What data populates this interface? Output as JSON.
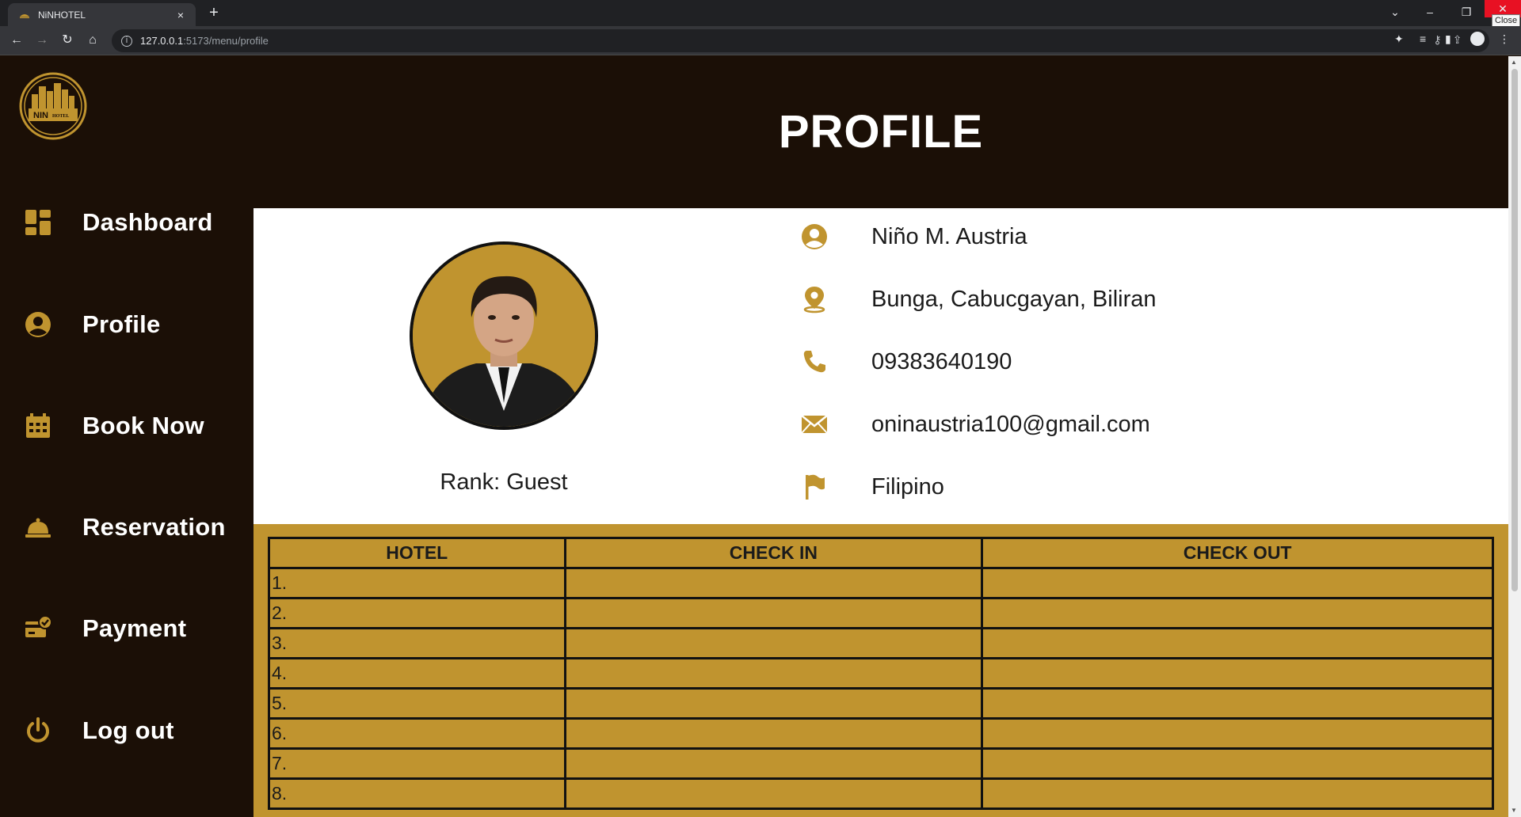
{
  "browser": {
    "tab_title": "NiNHOTEL",
    "tab_close": "×",
    "new_tab": "+",
    "url_host": "127.0.0.1",
    "url_path": ":5173/menu/profile",
    "close_tooltip": "Close"
  },
  "app": {
    "logo_text": "NIN HOTEL",
    "page_title": "PROFILE"
  },
  "sidebar": {
    "items": [
      {
        "label": "Dashboard",
        "icon": "dashboard-icon"
      },
      {
        "label": "Profile",
        "icon": "user-circle-icon"
      },
      {
        "label": "Book Now",
        "icon": "calendar-icon"
      },
      {
        "label": "Reservation",
        "icon": "service-bell-icon"
      },
      {
        "label": "Payment",
        "icon": "card-check-icon"
      },
      {
        "label": "Log out",
        "icon": "power-icon"
      }
    ]
  },
  "profile": {
    "rank": "Rank: Guest",
    "name": "Niño M. Austria",
    "address": "Bunga, Cabucgayan, Biliran",
    "phone": "09383640190",
    "email": "oninaustria100@gmail.com",
    "nationality": "Filipino"
  },
  "history": {
    "columns": [
      "HOTEL",
      "CHECK IN",
      "CHECK OUT"
    ],
    "rows": [
      "1.",
      "2.",
      "3.",
      "4.",
      "5.",
      "6.",
      "7.",
      "8."
    ]
  },
  "colors": {
    "accent": "#c0942f",
    "background": "#1b0f06",
    "card": "#ffffff"
  }
}
